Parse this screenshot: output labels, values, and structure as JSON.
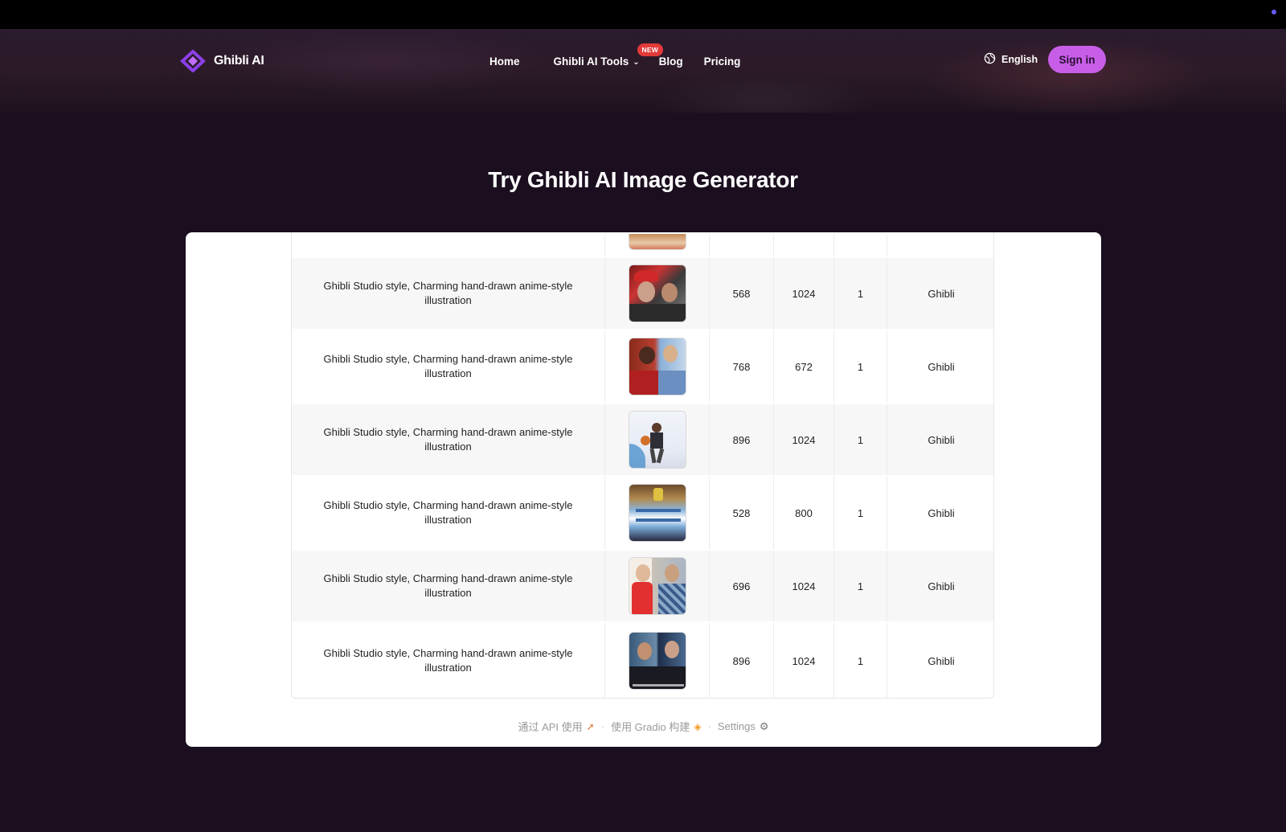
{
  "header": {
    "logo_text": "Ghibli AI",
    "nav": {
      "home": "Home",
      "tools": "Ghibli AI Tools",
      "tools_badge": "NEW",
      "blog": "Blog",
      "pricing": "Pricing"
    },
    "language": "English",
    "signin": "Sign in"
  },
  "main": {
    "title": "Try Ghibli AI Image Generator"
  },
  "table": {
    "rows": [
      {
        "prompt": "Ghibli Studio style, Charming hand-drawn anime-style illustration",
        "width": "568",
        "height": "1024",
        "num": "1",
        "style": "Ghibli",
        "thumb": "two-men-red-hat-photo"
      },
      {
        "prompt": "Ghibli Studio style, Charming hand-drawn anime-style illustration",
        "width": "768",
        "height": "672",
        "num": "1",
        "style": "Ghibli",
        "thumb": "two-people-selfie-photo"
      },
      {
        "prompt": "Ghibli Studio style, Charming hand-drawn anime-style illustration",
        "width": "896",
        "height": "1024",
        "num": "1",
        "style": "Ghibli",
        "thumb": "man-with-basketball-photo"
      },
      {
        "prompt": "Ghibli Studio style, Charming hand-drawn anime-style illustration",
        "width": "528",
        "height": "800",
        "num": "1",
        "style": "Ghibli",
        "thumb": "soccer-team-celebration-photo"
      },
      {
        "prompt": "Ghibli Studio style, Charming hand-drawn anime-style illustration",
        "width": "696",
        "height": "1024",
        "num": "1",
        "style": "Ghibli",
        "thumb": "woman-and-man-split-photo"
      },
      {
        "prompt": "Ghibli Studio style, Charming hand-drawn anime-style illustration",
        "width": "896",
        "height": "1024",
        "num": "1",
        "style": "Ghibli",
        "thumb": "two-men-glasses-photo"
      }
    ]
  },
  "footer": {
    "api": "通过 API 使用",
    "built": "使用 Gradio 构建",
    "settings": "Settings"
  },
  "colors": {
    "background": "#1a0e1f",
    "accent": "#c85ee8",
    "badge": "#e23a3a"
  }
}
